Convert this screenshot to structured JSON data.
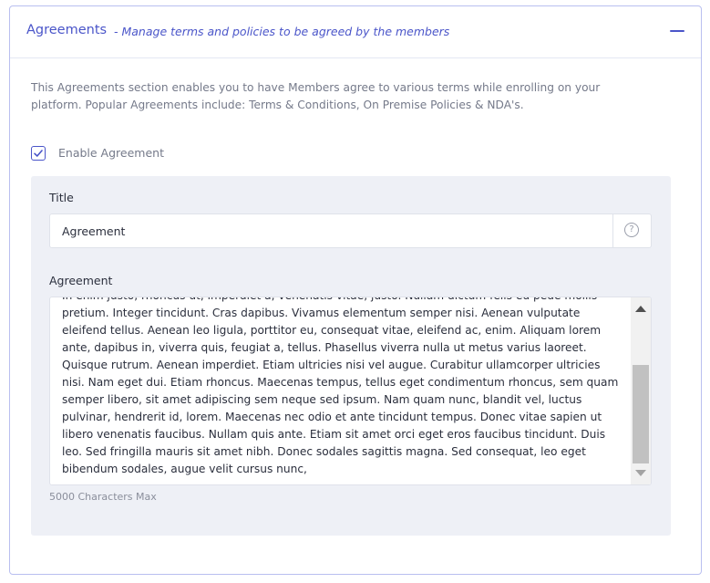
{
  "section": {
    "title": "Agreements",
    "subtitle": "- Manage terms and policies to be agreed by the members",
    "description": "This Agreements section enables you to have Members agree to various terms while enrolling on your platform. Popular Agreements include: Terms & Conditions, On Premise Policies & NDA's."
  },
  "enable_checkbox": {
    "label": "Enable Agreement",
    "checked": true
  },
  "form": {
    "title_label": "Title",
    "title_value": "Agreement",
    "help_icon": "question-circle-icon",
    "agreement_label": "Agreement",
    "agreement_text": "In enim justo, rhoncus ut, imperdiet a, venenatis vitae, justo. Nullam dictum felis eu pede mollis pretium. Integer tincidunt. Cras dapibus. Vivamus elementum semper nisi. Aenean vulputate eleifend tellus. Aenean leo ligula, porttitor eu, consequat vitae, eleifend ac, enim. Aliquam lorem ante, dapibus in, viverra quis, feugiat a, tellus. Phasellus viverra nulla ut metus varius laoreet. Quisque rutrum. Aenean imperdiet. Etiam ultricies nisi vel augue. Curabitur ullamcorper ultricies nisi. Nam eget dui. Etiam rhoncus. Maecenas tempus, tellus eget condimentum rhoncus, sem quam semper libero, sit amet adipiscing sem neque sed ipsum. Nam quam nunc, blandit vel, luctus pulvinar, hendrerit id, lorem. Maecenas nec odio et ante tincidunt tempus. Donec vitae sapien ut libero venenatis faucibus. Nullam quis ante. Etiam sit amet orci eget eros faucibus tincidunt. Duis leo. Sed fringilla mauris sit amet nibh. Donec sodales sagittis magna. Sed consequat, leo eget bibendum sodales, augue velit cursus nunc,",
    "char_limit": "5000 Characters Max"
  },
  "colors": {
    "accent": "#4a55c9",
    "panel_border": "#b9bff0",
    "inner_bg": "#eef0f6",
    "muted_text": "#757a8a"
  }
}
